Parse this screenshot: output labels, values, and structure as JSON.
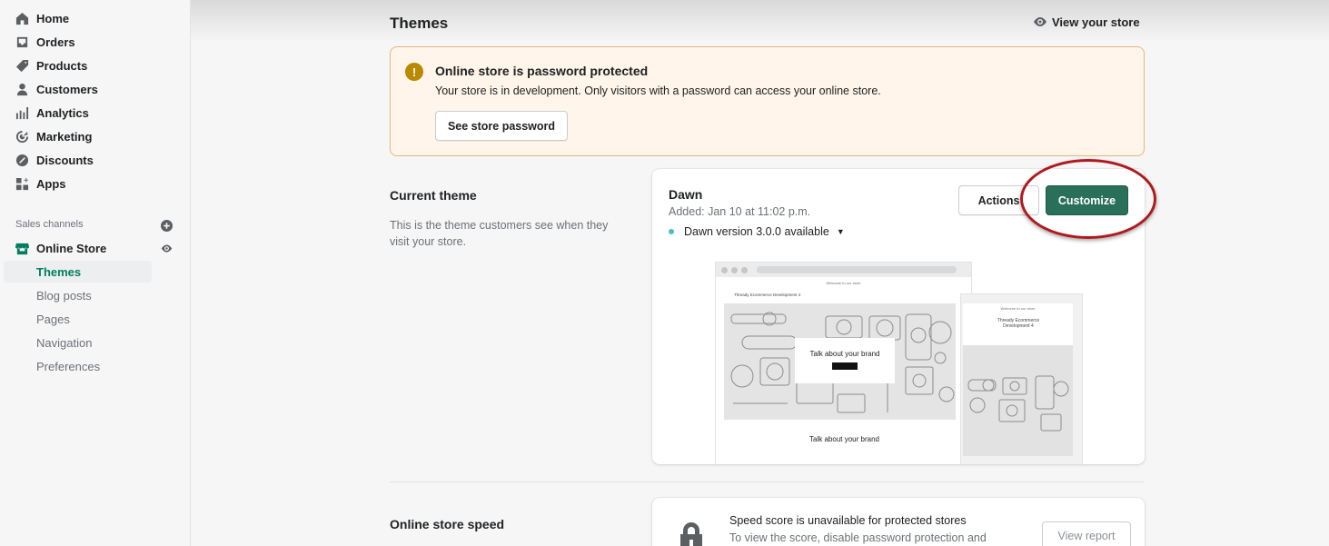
{
  "sidebar": {
    "items": [
      {
        "label": "Home",
        "icon": "home-icon"
      },
      {
        "label": "Orders",
        "icon": "orders-icon"
      },
      {
        "label": "Products",
        "icon": "tag-icon"
      },
      {
        "label": "Customers",
        "icon": "person-icon"
      },
      {
        "label": "Analytics",
        "icon": "bar-chart-icon"
      },
      {
        "label": "Marketing",
        "icon": "target-icon"
      },
      {
        "label": "Discounts",
        "icon": "discount-icon"
      },
      {
        "label": "Apps",
        "icon": "apps-icon"
      }
    ],
    "channels_label": "Sales channels",
    "online_store": {
      "label": "Online Store",
      "icon": "store-icon"
    },
    "sub_items": [
      {
        "label": "Themes",
        "active": true
      },
      {
        "label": "Blog posts",
        "active": false
      },
      {
        "label": "Pages",
        "active": false
      },
      {
        "label": "Navigation",
        "active": false
      },
      {
        "label": "Preferences",
        "active": false
      }
    ]
  },
  "header": {
    "title": "Themes",
    "view_store": "View your store"
  },
  "banner": {
    "title": "Online store is password protected",
    "text": "Your store is in development. Only visitors with a password can access your online store.",
    "button": "See store password"
  },
  "current_theme": {
    "title": "Current theme",
    "description": "This is the theme customers see when they visit your store.",
    "name": "Dawn",
    "added": "Added: Jan 10 at 11:02 p.m.",
    "version": "Dawn version 3.0.0 available",
    "actions_label": "Actions",
    "customize_label": "Customize",
    "preview": {
      "announcement": "Welcome to our store",
      "store_name": "Thready Ecommerce Development 4",
      "mobile_store_name": "Thready Ecommerce Development 4",
      "hero_heading": "Talk about your brand",
      "section_heading": "Talk about your brand"
    }
  },
  "speed": {
    "title": "Online store speed",
    "card_title": "Speed score is unavailable for protected stores",
    "card_text": "To view the score, disable password protection and",
    "button": "View report"
  },
  "colors": {
    "accent": "#2a6f59",
    "highlight_ring": "#b0191e",
    "banner_bg": "#fff5ea"
  }
}
